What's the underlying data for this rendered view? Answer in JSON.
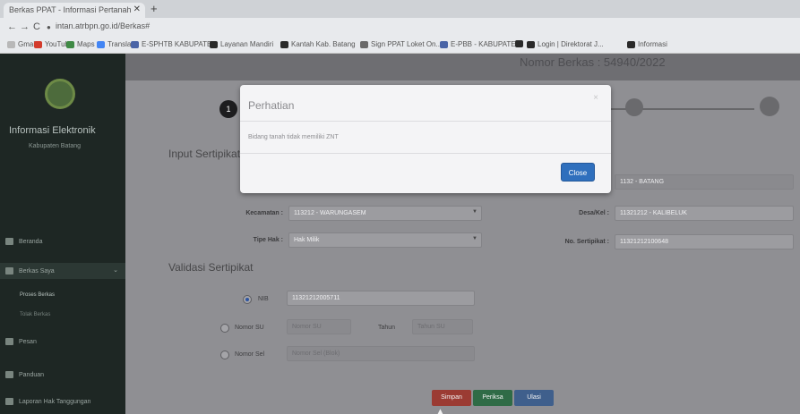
{
  "browser": {
    "tab_title": "Berkas PPAT - Informasi Pertanah",
    "tab_close": "✕",
    "new_tab": "+",
    "url": "intan.atrbpn.go.id/Berkas#",
    "bookmarks": [
      {
        "label": "Gmail",
        "color": "#b8b8b8"
      },
      {
        "label": "YouTube",
        "color": "#d33b2c"
      },
      {
        "label": "Maps",
        "color": "#3f8a45"
      },
      {
        "label": "Translate",
        "color": "#4285f4"
      },
      {
        "label": "E-SPHTB KABUPATE...",
        "color": "#4a64a6"
      },
      {
        "label": "Layanan Mandiri",
        "color": "#2a2a2a"
      },
      {
        "label": "Kantah Kab. Batang",
        "color": "#2a2a2a"
      },
      {
        "label": "Sign PPAT Loket On...",
        "color": "#6a6a6a"
      },
      {
        "label": "E-PBB - KABUPATE...",
        "color": "#4a64a6"
      },
      {
        "label": "",
        "color": "#2a2a2a"
      },
      {
        "label": "Login | Direktorat J...",
        "color": "#2a2a2a"
      },
      {
        "label": "Informasi",
        "color": "#2a2a2a"
      }
    ]
  },
  "app": {
    "page_title": "Nomor Berkas : 54940/2022",
    "brand": "Informasi Elektronik",
    "brand_sub": "Kabupaten Batang",
    "sidebar": {
      "beranda": "Beranda",
      "berkas_saya": "Berkas Saya",
      "proses_berkas": "Proses Berkas",
      "tolak_berkas": "Tolak Berkas",
      "pesan": "Pesan",
      "panduan": "Panduan",
      "laporan": "Laporan Hak Tanggungan"
    },
    "step1": "1",
    "input_title": "Input Sertipikat",
    "kabupaten_value": "1132 - BATANG",
    "kecamatan_label": "Kecamatan :",
    "kecamatan_value": "113212 - WARUNGASEM",
    "desa_label": "Desa/Kel :",
    "desa_value": "11321212 - KALIBELUK",
    "tipe_hak_label": "Tipe Hak :",
    "tipe_hak_value": "Hak Milik",
    "no_sertipikat_label": "No. Sertipikat :",
    "no_sertipikat_value": "11321212100648",
    "validasi_title": "Validasi Sertipikat",
    "nib_label": "NIB",
    "nib_value": "11321212005711",
    "nomor_su_label": "Nomor SU",
    "nomor_su_placeholder": "Nomor SU",
    "tahun_label": "Tahun",
    "tahun_placeholder": "Tahun SU",
    "nomor_sel_label": "Nomor Sel",
    "nomor_sel_placeholder": "Nomor Sel (Blok)",
    "btn_simpan": "Simpan",
    "btn_periksa": "Periksa",
    "btn_ulasi": "Ulasi"
  },
  "modal": {
    "title": "Perhatian",
    "close_x": "×",
    "message": "Bidang tanah tidak memiliki ZNT",
    "close_button": "Close"
  }
}
